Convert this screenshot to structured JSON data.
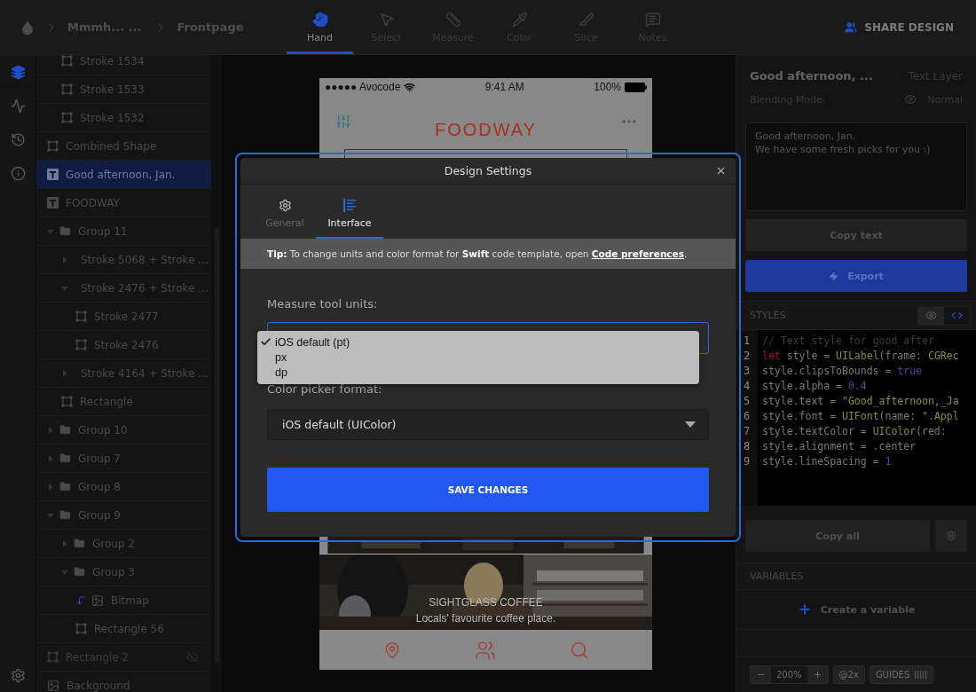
{
  "topbar": {
    "breadcrumbs": [
      "Mmmh... ...",
      "Frontpage"
    ],
    "tools": [
      {
        "label": "Hand",
        "selected": true
      },
      {
        "label": "Select",
        "selected": false
      },
      {
        "label": "Measure",
        "selected": false
      },
      {
        "label": "Color",
        "selected": false
      },
      {
        "label": "Slice",
        "selected": false
      },
      {
        "label": "Notes",
        "selected": false
      }
    ],
    "share": "SHARE DESIGN"
  },
  "rail": [
    {
      "selected": true
    },
    {
      "selected": false
    },
    {
      "selected": false
    },
    {
      "selected": false
    }
  ],
  "layers": [
    {
      "children": [
        {
          "kind": "shape",
          "label": "Stroke 1534",
          "selected": false
        },
        {
          "kind": "shape",
          "label": "Stroke 1533",
          "selected": false
        },
        {
          "kind": "shape",
          "label": "Stroke 1532",
          "selected": false
        }
      ]
    },
    {
      "kind": "shape",
      "label": "Combined Shape",
      "selected": false
    },
    {
      "kind": "text",
      "label": "Good afternoon, Jan.",
      "selected": true
    },
    {
      "kind": "text",
      "label": "FOODWAY",
      "selected": false
    },
    {
      "kind": "group",
      "label": "Group 11",
      "expanded": true,
      "selected": false,
      "children": [
        {
          "kind": "group",
          "label": "Stroke 5068 + Stroke ...",
          "expanded": false,
          "selected": false
        },
        {
          "kind": "group",
          "label": "Stroke 2476 + Stroke ...",
          "expanded": true,
          "selected": false,
          "children": [
            {
              "kind": "shape",
              "label": "Stroke 2477",
              "selected": false
            },
            {
              "kind": "shape",
              "label": "Stroke 2476",
              "selected": false
            }
          ]
        },
        {
          "kind": "group",
          "label": "Stroke 4164 + Stroke ...",
          "expanded": false,
          "selected": false
        },
        {
          "kind": "shape",
          "label": "Rectangle",
          "selected": false
        }
      ]
    },
    {
      "kind": "group",
      "label": "Group 10",
      "expanded": false,
      "selected": false
    },
    {
      "kind": "group",
      "label": "Group 7",
      "expanded": false,
      "selected": false
    },
    {
      "kind": "group",
      "label": "Group 8",
      "expanded": false,
      "selected": false
    },
    {
      "kind": "group",
      "label": "Group 9",
      "expanded": true,
      "selected": false,
      "children": [
        {
          "kind": "group",
          "label": "Group 2",
          "expanded": false,
          "selected": false
        },
        {
          "kind": "group",
          "label": "Group 3",
          "expanded": true,
          "selected": false,
          "children": [
            {
              "kind": "bitmap",
              "label": "Bitmap",
              "masked": true,
              "selected": false
            },
            {
              "kind": "shape",
              "label": "Rectangle 56",
              "selected": false
            }
          ]
        }
      ]
    },
    {
      "kind": "shape",
      "label": "Rectangle 2",
      "hidden": true,
      "selected": false
    },
    {
      "kind": "bitmap",
      "label": "Background",
      "selected": false
    }
  ],
  "phone": {
    "carrier": "●●●●● Avocode",
    "time": "9:41 AM",
    "battery": "100%",
    "brand": "FOODWAY",
    "place_title": "SIGHTGLASS COFFEE",
    "place_subtitle": "Locals' favourite coffee place."
  },
  "dialog": {
    "title": "Design Settings",
    "tabs": [
      {
        "label": "General",
        "selected": false
      },
      {
        "label": "Interface",
        "selected": true
      }
    ],
    "tip": {
      "text_before": "**Tip:** To change units and color format for **Swift** code template, open ",
      "link": "Code preferences",
      "text_after": "."
    },
    "measure_label": "Measure tool units:",
    "measure_options": [
      {
        "label": "iOS default (pt)",
        "selected": true
      },
      {
        "label": "px",
        "selected": false
      },
      {
        "label": "dp",
        "selected": false
      }
    ],
    "color_label": "Color picker format:",
    "color_value": "iOS default (UIColor)",
    "save": "SAVE CHANGES"
  },
  "inspector": {
    "layer_name": "Good afternoon, ...",
    "layer_type": "Text Layer",
    "blending_label": "Blending Mode:",
    "blending_value": "Normal",
    "text_lines": [
      "Good afternoon, Jan.",
      "We have some fresh picks for you :)"
    ],
    "copy_text": "Copy text",
    "export": "Export",
    "styles_title": "STYLES",
    "view_modes": [
      {
        "selected": false
      },
      {
        "selected": true
      }
    ],
    "code": [
      {
        "number": "1",
        "tokens": [
          {
            "kind": "comment",
            "text": "// Text style for good_after"
          }
        ]
      },
      {
        "number": "2",
        "tokens": [
          {
            "kind": "keyword",
            "text": "let"
          },
          {
            "kind": "plain",
            "text": " style = "
          },
          {
            "kind": "type",
            "text": "UILabel"
          },
          {
            "kind": "plain",
            "text": "(frame: "
          },
          {
            "kind": "type",
            "text": "CGRec"
          }
        ]
      },
      {
        "number": "3",
        "tokens": [
          {
            "kind": "plain",
            "text": "style.clipsToBounds = "
          },
          {
            "kind": "number",
            "text": "true"
          }
        ]
      },
      {
        "number": "4",
        "tokens": [
          {
            "kind": "plain",
            "text": "style.alpha = "
          },
          {
            "kind": "number",
            "text": "0.4"
          }
        ]
      },
      {
        "number": "5",
        "tokens": [
          {
            "kind": "plain",
            "text": "style.text = "
          },
          {
            "kind": "string",
            "text": "\"Good_afternoon,_Ja"
          }
        ]
      },
      {
        "number": "6",
        "tokens": [
          {
            "kind": "plain",
            "text": "style.font = "
          },
          {
            "kind": "type",
            "text": "UIFont"
          },
          {
            "kind": "plain",
            "text": "(name: "
          },
          {
            "kind": "string",
            "text": "\".Appl"
          }
        ]
      },
      {
        "number": "7",
        "tokens": [
          {
            "kind": "plain",
            "text": "style.textColor = "
          },
          {
            "kind": "type",
            "text": "UIColor"
          },
          {
            "kind": "plain",
            "text": "(red: "
          }
        ]
      },
      {
        "number": "8",
        "tokens": [
          {
            "kind": "plain",
            "text": "style.alignment = .center"
          }
        ]
      },
      {
        "number": "9",
        "tokens": [
          {
            "kind": "plain",
            "text": "style.lineSpacing = "
          },
          {
            "kind": "number",
            "text": "1"
          }
        ]
      }
    ],
    "copy_all": "Copy all",
    "variables_title": "VARIABLES",
    "create_variable": "Create a variable"
  },
  "zoombar": {
    "zoom": "200%",
    "scale": "@2x",
    "guides": "GUIDES"
  }
}
